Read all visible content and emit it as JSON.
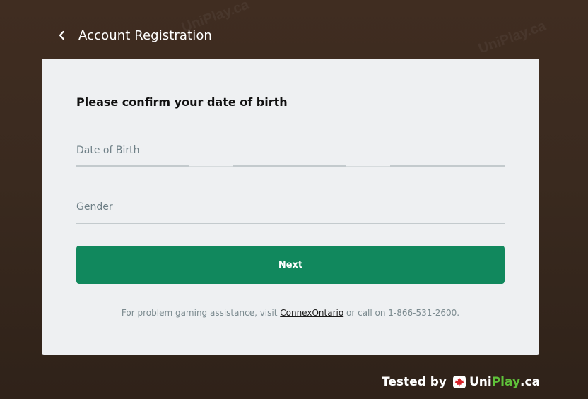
{
  "header": {
    "title": "Account Registration"
  },
  "form": {
    "heading": "Please confirm your date of birth",
    "dob_label": "Date of Birth",
    "gender_label": "Gender",
    "next_label": "Next"
  },
  "assistance": {
    "prefix": "For problem gaming assistance, visit ",
    "link_text": "ConnexOntario",
    "suffix": " or call on 1-866-531-2600."
  },
  "footer": {
    "tested_by": "Tested by",
    "brand_uni": "Uni",
    "brand_play": "Play",
    "brand_ca": ".ca"
  },
  "watermark": {
    "text": "UniPlay.ca"
  },
  "colors": {
    "background": "#3a2a1f",
    "card": "#eef0f2",
    "primary_button": "#11885d",
    "brand_green": "#5fc13a",
    "maple_red": "#d8232a"
  },
  "icons": {
    "back": "chevron-left-icon",
    "brand": "maple-leaf-icon"
  }
}
